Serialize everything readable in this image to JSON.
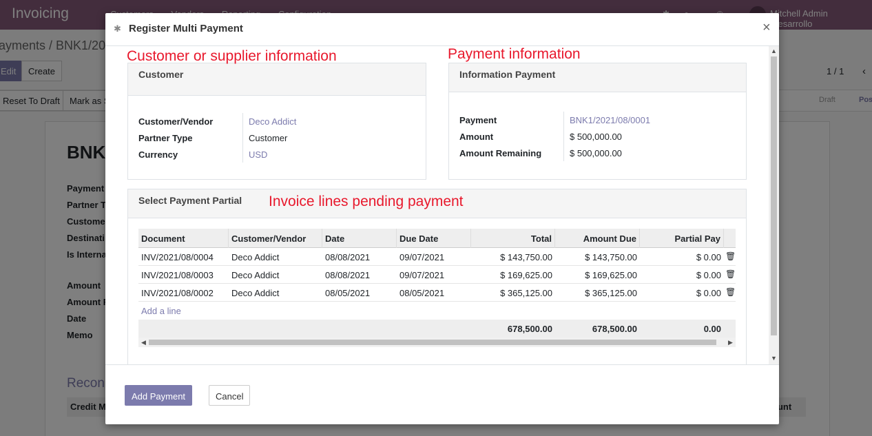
{
  "background": {
    "app_name": "Invoicing",
    "menu": [
      "Customers",
      "Vendors",
      "Reporting",
      "Configuration"
    ],
    "user": "Mitchell Admin (desarrollo",
    "breadcrumb": "ayments / BNK1/20",
    "edit_label": "Edit",
    "create_label": "Create",
    "pager": "1 / 1",
    "reset_label": "Reset To Draft",
    "mark_label": "Mark as S",
    "status_draft": "Draft",
    "status_posted": "Pos",
    "record_title": "BNK",
    "labels": [
      "Payment",
      "Partner T",
      "Custome",
      "Destinati",
      "Is Interna",
      "Amount",
      "Amount F",
      "Date",
      "Memo"
    ],
    "recon_title": "Recon",
    "credit_header": "Credit M",
    "amount_header": "ount"
  },
  "modal": {
    "title": "Register Multi Payment",
    "close": "×"
  },
  "annotations": {
    "customer": "Customer or supplier information",
    "payment": "Payment information",
    "invoice": "Invoice lines pending payment"
  },
  "customer_group": {
    "title": "Customer",
    "fields": [
      {
        "label": "Customer/Vendor",
        "value": "Deco Addict"
      },
      {
        "label": "Partner Type",
        "value": "Customer"
      },
      {
        "label": "Currency",
        "value": "USD"
      }
    ]
  },
  "payment_group": {
    "title": "Information Payment",
    "fields": [
      {
        "label": "Payment",
        "value": "BNK1/2021/08/0001"
      },
      {
        "label": "Amount",
        "value": "$ 500,000.00"
      },
      {
        "label": "Amount Remaining",
        "value": "$ 500,000.00"
      }
    ]
  },
  "partial_group": {
    "title": "Select Payment Partial",
    "columns": [
      "Document",
      "Customer/Vendor",
      "Date",
      "Due Date",
      "Total",
      "Amount Due",
      "Partial Pay"
    ],
    "rows": [
      [
        "INV/2021/08/0004",
        "Deco Addict",
        "08/08/2021",
        "09/07/2021",
        "$ 143,750.00",
        "$ 143,750.00",
        "$ 0.00"
      ],
      [
        "INV/2021/08/0003",
        "Deco Addict",
        "08/08/2021",
        "09/07/2021",
        "$ 169,625.00",
        "$ 169,625.00",
        "$ 0.00"
      ],
      [
        "INV/2021/08/0002",
        "Deco Addict",
        "08/05/2021",
        "08/05/2021",
        "$ 365,125.00",
        "$ 365,125.00",
        "$ 0.00"
      ]
    ],
    "add_line": "Add a line",
    "totals": {
      "total": "678,500.00",
      "amount_due": "678,500.00",
      "partial_pay": "0.00"
    }
  },
  "footer": {
    "add_payment": "Add Payment",
    "cancel": "Cancel"
  },
  "colors": {
    "brand": "#875a7b",
    "primary": "#7c7bad",
    "annotation": "#e8182c"
  }
}
